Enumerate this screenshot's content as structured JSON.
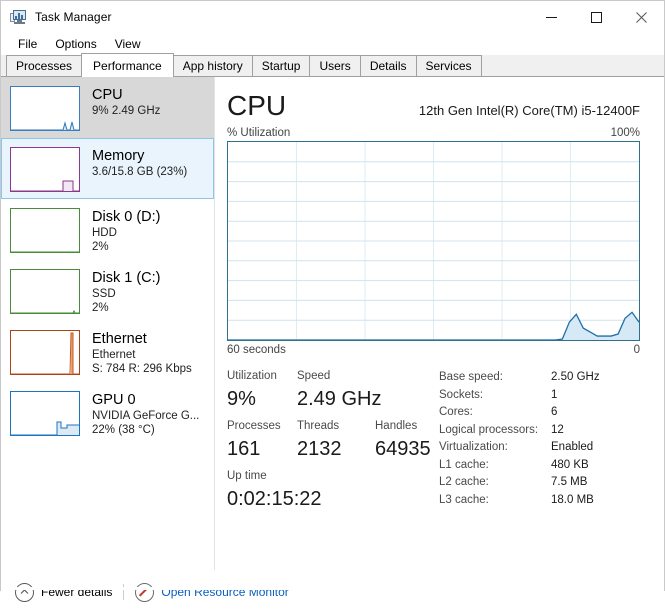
{
  "window": {
    "title": "Task Manager",
    "icon": "task-manager-icon",
    "controls": {
      "minimize": "minimize",
      "maximize": "maximize",
      "close": "close"
    }
  },
  "menu": {
    "items": [
      "File",
      "Options",
      "View"
    ]
  },
  "tabs": {
    "active": "Performance",
    "items": [
      "Processes",
      "Performance",
      "App history",
      "Startup",
      "Users",
      "Details",
      "Services"
    ]
  },
  "sidebar": {
    "items": [
      {
        "name": "CPU",
        "line1": "9% 2.49 GHz",
        "line2": "",
        "color": "#3a7ebf",
        "state": "selected"
      },
      {
        "name": "Memory",
        "line1": "3.6/15.8 GB (23%)",
        "line2": "",
        "color": "#8a3a8a",
        "state": "hover"
      },
      {
        "name": "Disk 0 (D:)",
        "line1": "HDD",
        "line2": "2%",
        "color": "#4a8a3a",
        "state": "normal"
      },
      {
        "name": "Disk 1 (C:)",
        "line1": "SSD",
        "line2": "2%",
        "color": "#4a8a3a",
        "state": "normal"
      },
      {
        "name": "Ethernet",
        "line1": "Ethernet",
        "line2": "S: 784 R: 296 Kbps",
        "color": "#a8441a",
        "state": "normal"
      },
      {
        "name": "GPU 0",
        "line1": "NVIDIA GeForce G...",
        "line2": "22%  (38 °C)",
        "color": "#1b74bd",
        "state": "normal"
      }
    ]
  },
  "main": {
    "title": "CPU",
    "model": "12th Gen Intel(R) Core(TM) i5-12400F",
    "graph_label": "% Utilization",
    "graph_max": "100%",
    "graph_time": "60 seconds",
    "graph_min": "0"
  },
  "chart_data": {
    "type": "area",
    "title": "% Utilization",
    "xlabel": "60 seconds",
    "ylabel": "% Utilization",
    "ylim": [
      0,
      100
    ],
    "xlim": [
      60,
      0
    ],
    "grid": true,
    "grid_cols": 6,
    "grid_rows": 10,
    "line_color": "#1f6fa8",
    "fill_color": "#d6e9f6",
    "values": [
      0,
      0,
      0,
      0,
      0,
      0,
      0,
      0,
      0,
      0,
      0,
      0,
      0,
      0,
      0,
      0,
      0,
      0,
      0,
      0,
      0,
      0,
      0,
      0,
      0,
      0,
      0,
      0,
      0,
      0,
      0,
      0,
      0,
      0,
      0,
      0,
      0,
      0,
      0,
      0,
      0,
      0,
      0,
      0,
      0,
      0,
      0,
      0,
      0.5,
      9,
      13,
      6,
      4,
      2,
      2,
      2,
      3,
      11,
      14,
      9
    ]
  },
  "stats": {
    "primary": [
      {
        "label": "Utilization",
        "value": "9%"
      },
      {
        "label": "Speed",
        "value": "2.49 GHz"
      }
    ],
    "secondary": [
      {
        "label": "Processes",
        "value": "161"
      },
      {
        "label": "Threads",
        "value": "2132"
      },
      {
        "label": "Handles",
        "value": "64935"
      }
    ],
    "uptime": {
      "label": "Up time",
      "value": "0:02:15:22"
    },
    "specs": [
      {
        "key": "Base speed:",
        "value": "2.50 GHz"
      },
      {
        "key": "Sockets:",
        "value": "1"
      },
      {
        "key": "Cores:",
        "value": "6"
      },
      {
        "key": "Logical processors:",
        "value": "12"
      },
      {
        "key": "Virtualization:",
        "value": "Enabled"
      },
      {
        "key": "L1 cache:",
        "value": "480 KB"
      },
      {
        "key": "L2 cache:",
        "value": "7.5 MB"
      },
      {
        "key": "L3 cache:",
        "value": "18.0 MB"
      }
    ]
  },
  "footer": {
    "fewer_details": "Fewer details",
    "resource_monitor": "Open Resource Monitor",
    "link_color": "#0a5fbd"
  }
}
